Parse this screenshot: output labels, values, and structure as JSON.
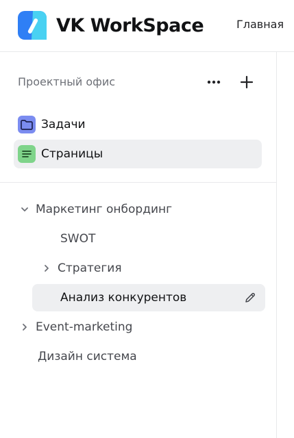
{
  "header": {
    "app_title": "VK WorkSpace",
    "nav_home": "Главная",
    "logo_icon": "vk-workspace-logo-icon"
  },
  "sidebar": {
    "section_title": "Проектный офис",
    "more_icon": "more-horizontal-icon",
    "add_icon": "plus-icon",
    "menu": [
      {
        "label": "Задачи",
        "icon": "folder-icon",
        "icon_color": "#7b8cf0",
        "active": false
      },
      {
        "label": "Страницы",
        "icon": "document-lines-icon",
        "icon_color": "#7fd48a",
        "active": true
      }
    ],
    "tree": [
      {
        "label": "Маркетинг онбординг",
        "level": 0,
        "expander": "chevron-down-icon"
      },
      {
        "label": "SWOT",
        "level": 1,
        "expander": null
      },
      {
        "label": "Стратегия",
        "level": 1,
        "expander": "chevron-right-icon"
      },
      {
        "label": "Анализ конкурентов",
        "level": 1,
        "expander": null,
        "selected": true,
        "action_icon": "pencil-icon"
      },
      {
        "label": "Event-marketing",
        "level": 0,
        "expander": "chevron-right-icon"
      },
      {
        "label": "Дизайн система",
        "level": 0,
        "expander": null
      }
    ]
  },
  "colors": {
    "logo_blue": "#2f7ff5",
    "logo_cyan": "#49d1f2",
    "selected_bg": "#eeeff1",
    "muted_text": "#6d7077"
  }
}
